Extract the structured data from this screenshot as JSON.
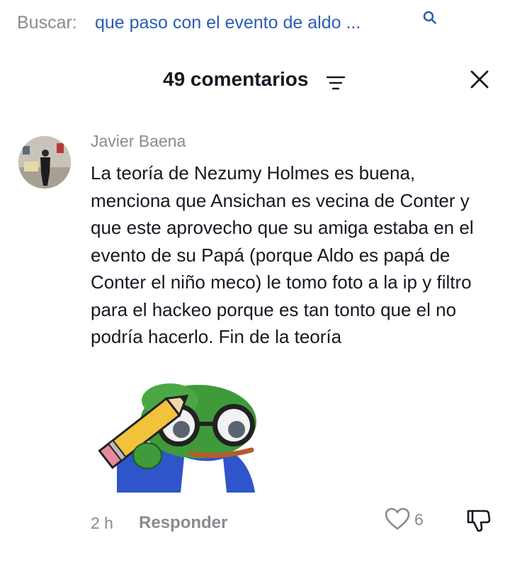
{
  "search": {
    "prefix": "Buscar:",
    "query": "que paso con el evento de aldo ...",
    "icon": "search-icon"
  },
  "header": {
    "comment_count": "49 comentarios",
    "sort_icon": "sort-icon",
    "close_icon": "close-icon"
  },
  "comment": {
    "author": "Javier Baena",
    "text": "La teoría de Nezumy Holmes es buena, menciona que Ansichan es vecina de Conter y que este aprovecho que su amiga estaba en el evento de su Papá (porque Aldo es papá de Conter el niño meco) le tomo foto a la ip y filtro para el hackeo porque es tan tonto que el no podría hacerlo. Fin de la teoría",
    "sticker": "pepe-frog-pencil-sticker",
    "time": "2 h",
    "reply_label": "Responder",
    "likes": "6"
  },
  "colors": {
    "link": "#2b5db9",
    "muted": "#8a8b91",
    "text": "#161823"
  }
}
